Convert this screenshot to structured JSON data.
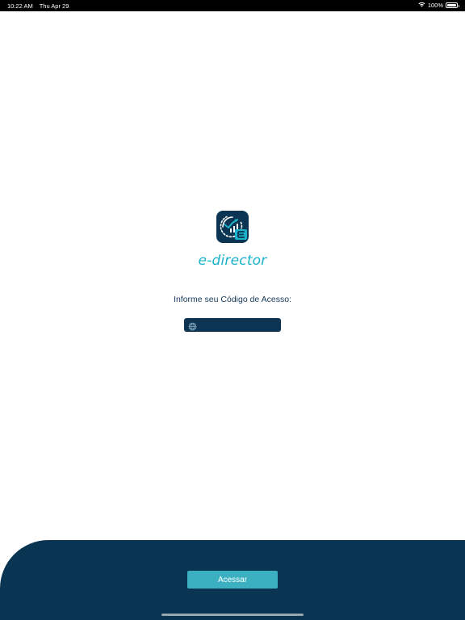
{
  "status_bar": {
    "time": "10:22 AM",
    "date": "Thu Apr 29",
    "battery_percent": "100%",
    "wifi_icon": "wifi-icon",
    "battery_icon": "battery-icon",
    "battery_level": 1.0
  },
  "brand": {
    "app_name": "e-director",
    "logo_icon": "e-director-logo-icon",
    "colors": {
      "accent": "#1ab2c9",
      "navy": "#0a3552",
      "button": "#3ab0c0"
    }
  },
  "login": {
    "prompt": "Informe seu Código de Acesso:",
    "input_icon": "globe-icon",
    "code_value": "",
    "code_placeholder": ""
  },
  "footer": {
    "access_button_label": "Acessar"
  }
}
